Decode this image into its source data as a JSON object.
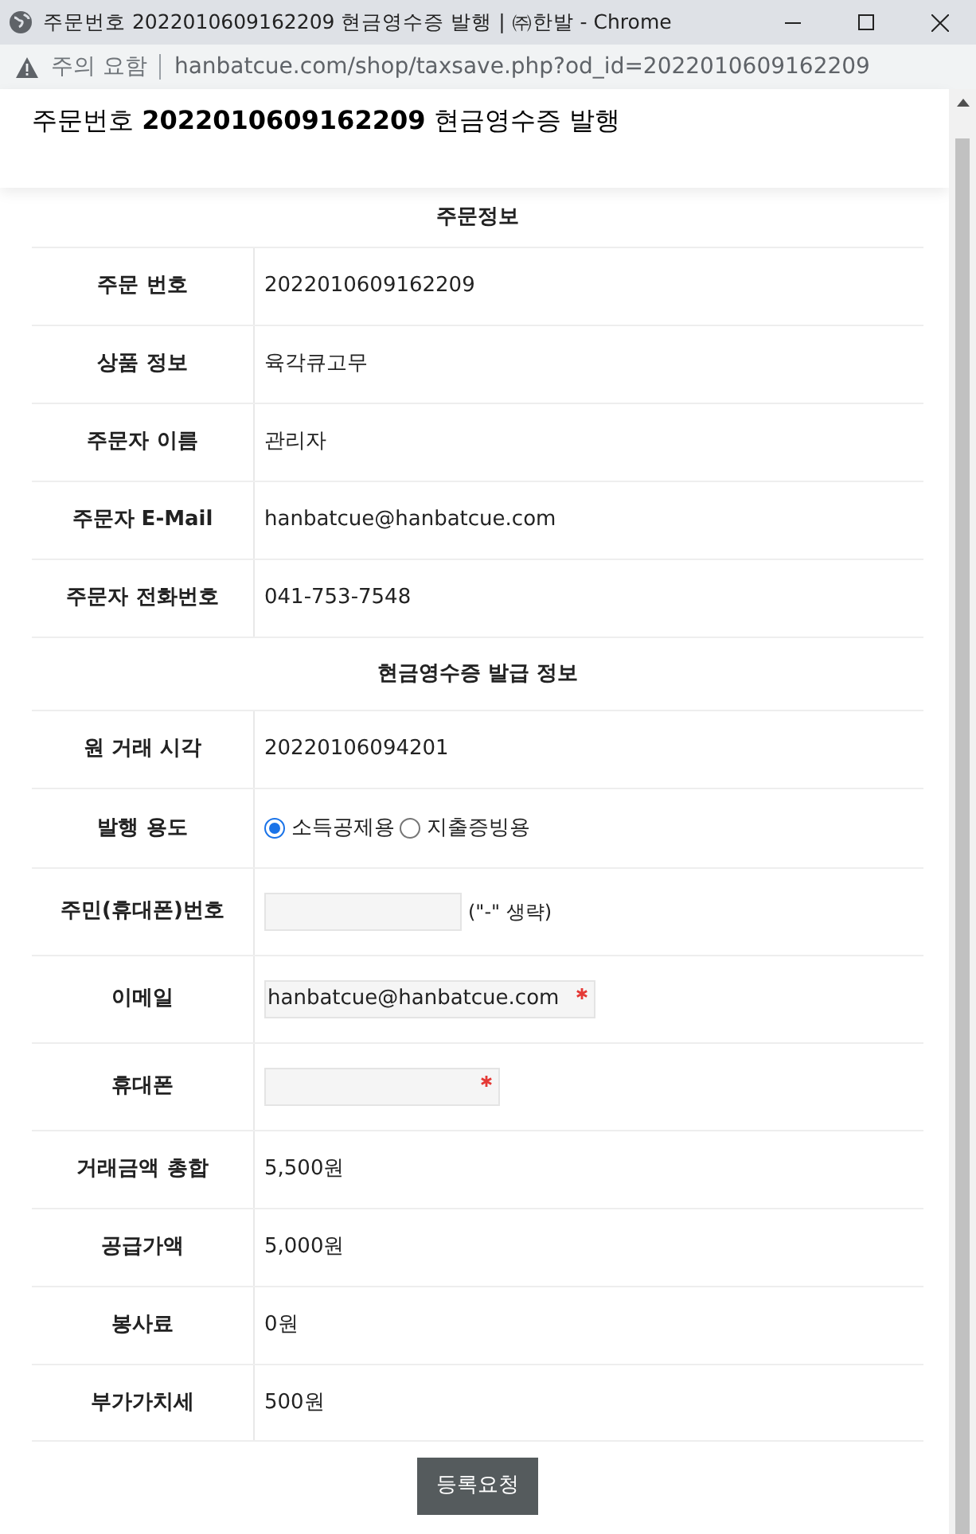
{
  "window": {
    "title": "주문번호 2022010609162209 현금영수증 발행 | ㈜한발 - Chrome"
  },
  "address_bar": {
    "security": "주의 요함",
    "url": "hanbatcue.com/shop/taxsave.php?od_id=2022010609162209"
  },
  "page_title": "주문번호 **2022010609162209** 현금영수증 발행",
  "order_info": {
    "title": "주문정보",
    "rows": [
      {
        "label": "주문 번호",
        "value": "2022010609162209"
      },
      {
        "label": "상품 정보",
        "value": "육각큐고무"
      },
      {
        "label": "주문자 이름",
        "value": "관리자"
      },
      {
        "label": "주문자 E-Mail",
        "value": "hanbatcue@hanbatcue.com"
      },
      {
        "label": "주문자 전화번호",
        "value": "041-753-7548"
      }
    ]
  },
  "receipt_info": {
    "title": "현금영수증 발급 정보",
    "rows": [
      {
        "kind": "text",
        "label": "원 거래 시각",
        "value": "20220106094201"
      },
      {
        "kind": "radio",
        "label": "발행 용도",
        "options": [
          {
            "label": "소득공제용",
            "selected": true
          },
          {
            "label": "지출증빙용",
            "selected": false
          }
        ]
      },
      {
        "kind": "input",
        "label": "주민(휴대폰)번호",
        "note": "(\"-\" 생략)",
        "required": false
      },
      {
        "kind": "input",
        "label": "이메일",
        "value": "hanbatcue@hanbatcue.com",
        "required": true
      },
      {
        "kind": "input",
        "label": "휴대폰",
        "required": true
      },
      {
        "kind": "text",
        "label": "거래금액 총합",
        "value": "5,500원"
      },
      {
        "kind": "text",
        "label": "공급가액",
        "value": "5,000원"
      },
      {
        "kind": "text",
        "label": "봉사료",
        "value": "0원"
      },
      {
        "kind": "text",
        "label": "부가가치세",
        "value": "500원"
      }
    ]
  },
  "submit_button": "등록요청"
}
